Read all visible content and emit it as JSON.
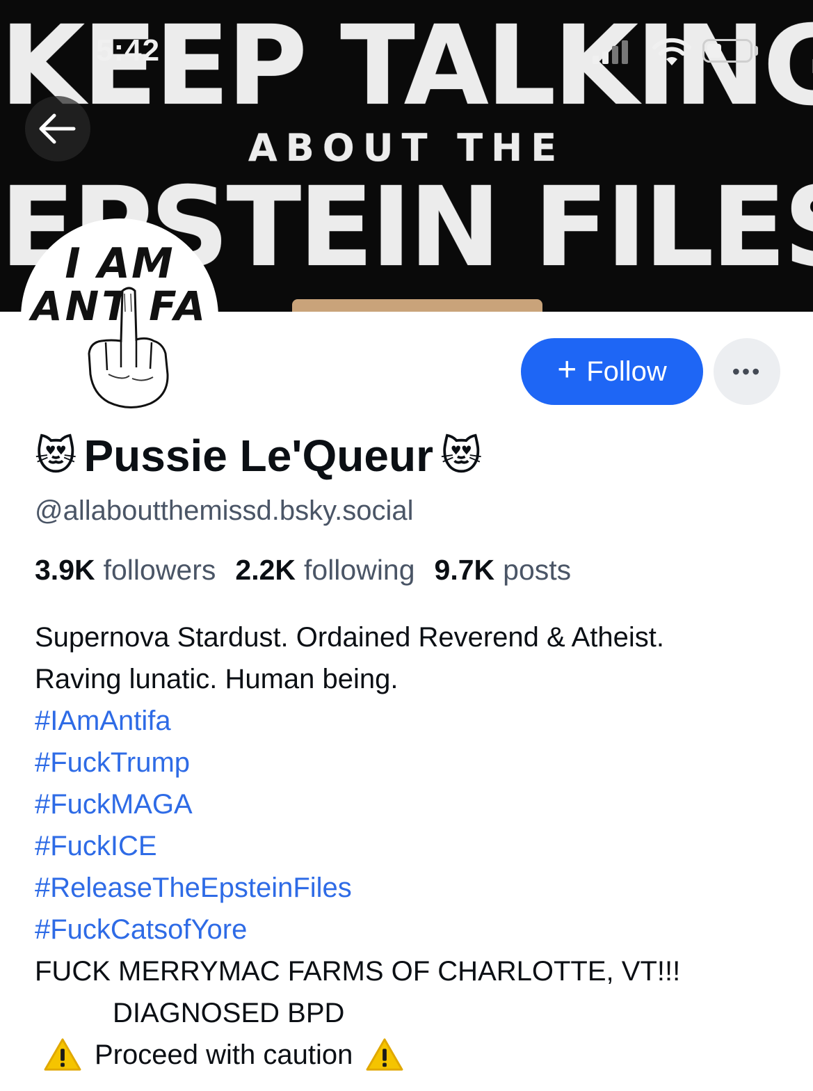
{
  "status_bar": {
    "time": "5:42",
    "icons": [
      "signal-icon",
      "wifi-icon",
      "battery-icon"
    ]
  },
  "banner": {
    "line1": "KEEP TALKING",
    "line2": "ABOUT THE",
    "line3": "EPSTEIN FILES"
  },
  "avatar": {
    "line1": "I AM",
    "line2": "ANT  FA"
  },
  "actions": {
    "follow_label": "Follow",
    "more_label": "•••"
  },
  "profile": {
    "name": "Pussie Le'Queur",
    "name_emoji": "😻",
    "handle": "@allaboutthemissd.bsky.social",
    "stats": {
      "followers_count": "3.9K",
      "followers_label": "followers",
      "following_count": "2.2K",
      "following_label": "following",
      "posts_count": "9.7K",
      "posts_label": "posts"
    }
  },
  "bio": {
    "line1": "Supernova Stardust. Ordained Reverend & Atheist.",
    "line2": "Raving lunatic. Human being.",
    "tags": [
      "#IAmAntifa",
      "#FuckTrump",
      "#FuckMAGA",
      "#FuckICE",
      "#ReleaseTheEpsteinFiles",
      "#FuckCatsofYore"
    ],
    "line3": "FUCK MERRYMAC FARMS OF CHARLOTTE, VT!!!",
    "line4": "DIAGNOSED BPD",
    "line5": "Proceed with caution"
  },
  "colors": {
    "accent": "#1e66f5",
    "link": "#2e6be6",
    "muted": "#4a5566",
    "warning": "#f5c400"
  }
}
